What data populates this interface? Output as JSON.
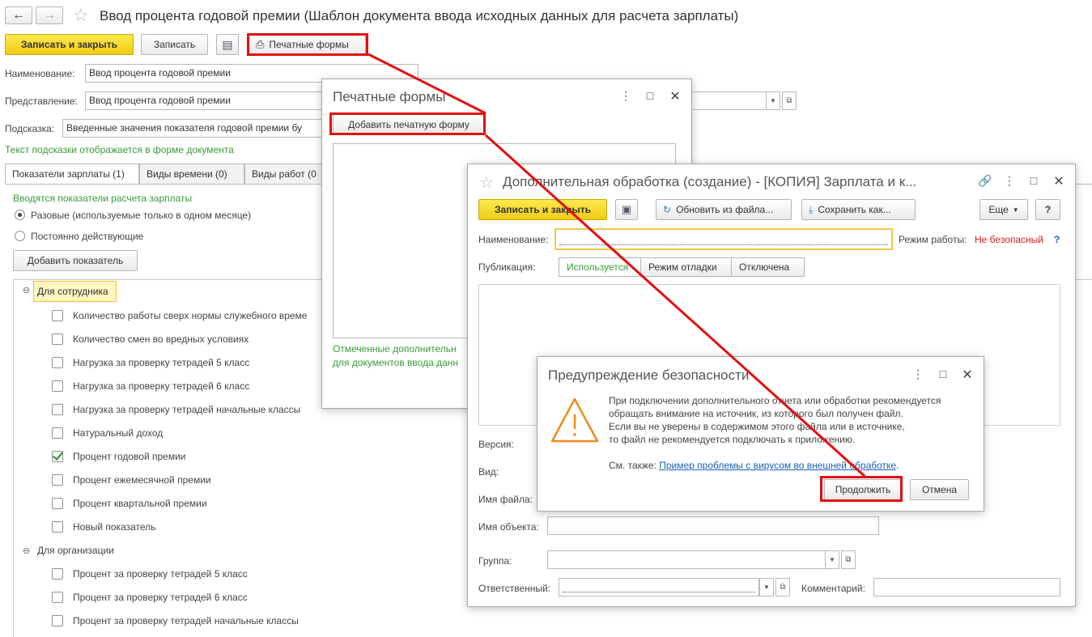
{
  "main": {
    "title": "Ввод процента годовой премии (Шаблон документа ввода исходных данных для расчета зарплаты)",
    "toolbar": {
      "save_close": "Записать и закрыть",
      "save": "Записать",
      "print_forms": "Печатные формы"
    },
    "fields": {
      "name_label": "Наименование:",
      "name_value": "Ввод процента годовой премии",
      "repr_label": "Представление:",
      "repr_value": "Ввод процента годовой премии",
      "hint_label": "Подсказка:",
      "hint_value": "Введенные значения показателя годовой премии бу",
      "hint_note": "Текст подсказки отображается в форме документа"
    },
    "tabs": [
      {
        "label": "Показатели зарплаты (1)"
      },
      {
        "label": "Виды времени (0)"
      },
      {
        "label": "Виды работ (0"
      }
    ],
    "indicators": {
      "heading": "Вводятся показатели расчета зарплаты",
      "radio_once": "Разовые (используемые только в одном месяце)",
      "radio_const": "Постоянно действующие",
      "add_button": "Добавить показатель",
      "group_employee": "Для сотрудника",
      "employee_items": [
        {
          "label": "Количество работы сверх нормы служебного време",
          "checked": false
        },
        {
          "label": "Количество смен во вредных условиях",
          "checked": false
        },
        {
          "label": "Нагрузка за проверку тетрадей 5 класс",
          "checked": false
        },
        {
          "label": "Нагрузка за проверку тетрадей 6 класс",
          "checked": false
        },
        {
          "label": "Нагрузка за проверку тетрадей начальные классы",
          "checked": false
        },
        {
          "label": "Натуральный доход",
          "checked": false
        },
        {
          "label": "Процент годовой премии",
          "checked": true
        },
        {
          "label": "Процент ежемесячной премии",
          "checked": false
        },
        {
          "label": "Процент квартальной премии",
          "checked": false
        },
        {
          "label": "Новый показатель",
          "checked": false
        }
      ],
      "group_org": "Для организации",
      "org_items": [
        {
          "label": "Процент за проверку тетрадей 5 класс",
          "checked": false
        },
        {
          "label": "Процент за проверку тетрадей 6 класс",
          "checked": false
        },
        {
          "label": "Процент за проверку тетрадей начальные классы",
          "checked": false
        }
      ]
    }
  },
  "print_forms_dialog": {
    "title": "Печатные формы",
    "add_button": "Добавить печатную форму",
    "note_line1": "Отмеченные дополнительн",
    "note_line2": "для документов ввода данн"
  },
  "processing_dialog": {
    "title": "Дополнительная обработка (создание) - [КОПИЯ] Зарплата и к...",
    "save_close": "Записать и закрыть",
    "update_from_file": "Обновить из файла...",
    "save_as": "Сохранить как...",
    "more": "Еще",
    "help": "?",
    "name_label": "Наименование:",
    "mode_label": "Режим работы:",
    "mode_value": "Не безопасный",
    "mode_help": "?",
    "publication_label": "Публикация:",
    "publication_options": [
      "Используется",
      "Режим отладки",
      "Отключена"
    ],
    "version_label": "Версия:",
    "kind_label": "Вид:",
    "filename_label": "Имя файла:",
    "object_label": "Имя объекта:",
    "group_label": "Группа:",
    "responsible_label": "Ответственный:",
    "comment_label": "Комментарий:"
  },
  "warning_dialog": {
    "title": "Предупреждение безопасности",
    "text_lines": [
      "При подключении дополнительного отчета или обработки рекомендуется",
      "обращать внимание на источник, из которого был получен файл.",
      "Если вы не уверены в содержимом этого файла или в источнике,",
      "то файл не рекомендуется подключать к приложению."
    ],
    "see_also": "См. также:",
    "link": "Пример проблемы с вирусом во внешней обработке",
    "link_suffix": ".",
    "continue": "Продолжить",
    "cancel": "Отмена"
  },
  "colors": {
    "accent_yellow": "#f2cb16",
    "highlight_red": "#e01010",
    "link_blue": "#1a5fb4",
    "ok_green": "#3a9a3a",
    "warning_orange": "#f08a1c"
  }
}
